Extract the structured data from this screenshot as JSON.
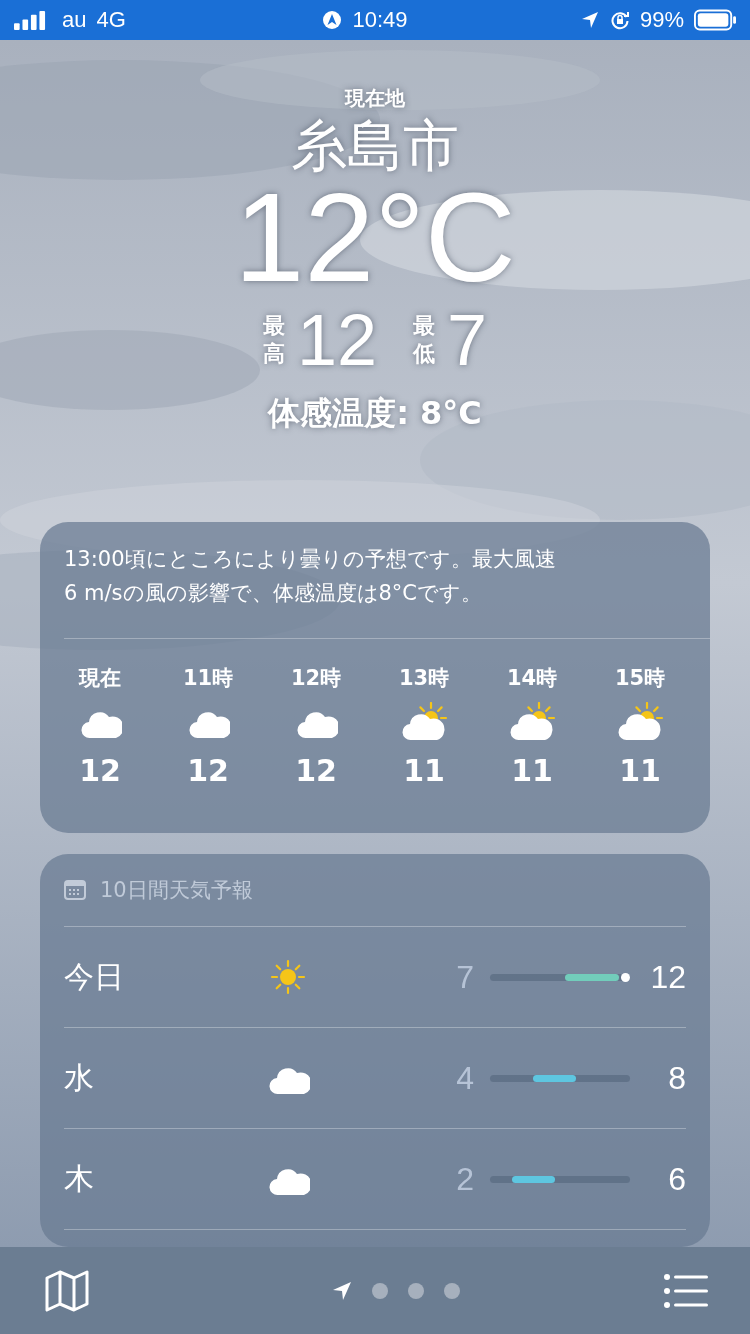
{
  "status_bar": {
    "carrier": "au",
    "network": "4G",
    "time": "10:49",
    "battery": "99%"
  },
  "header": {
    "label": "現在地",
    "city": "糸島市",
    "temperature": "12°C",
    "high_label": "最高",
    "high": "12",
    "low_label": "最低",
    "low": "7",
    "feels_like": "体感温度: 8°C"
  },
  "hourly": {
    "summary": "13:00頃にところにより曇りの予想です。最大風速\n6 m/sの風の影響で、体感温度は8°Cです。",
    "hours": [
      {
        "time": "現在",
        "kind": "cloud",
        "temp": "12"
      },
      {
        "time": "11時",
        "kind": "cloud",
        "temp": "12"
      },
      {
        "time": "12時",
        "kind": "cloud",
        "temp": "12"
      },
      {
        "time": "13時",
        "kind": "suncloud",
        "temp": "11"
      },
      {
        "time": "14時",
        "kind": "suncloud",
        "temp": "11"
      },
      {
        "time": "15時",
        "kind": "suncloud",
        "temp": "11"
      }
    ]
  },
  "daily": {
    "title": "10日間天気予報",
    "days": [
      {
        "day": "今日",
        "kind": "sun",
        "low": "7",
        "high": "12",
        "current_dot": true,
        "color": "#72cdbb"
      },
      {
        "day": "水",
        "kind": "cloud",
        "low": "4",
        "high": "8",
        "current_dot": false,
        "color": "#5ec6e0"
      },
      {
        "day": "木",
        "kind": "cloud",
        "low": "2",
        "high": "6",
        "current_dot": false,
        "color": "#5ec6e0"
      }
    ]
  },
  "tab_bar": {
    "pages": [
      {
        "kind": "location",
        "selected": true
      },
      {
        "kind": "dot",
        "selected": false
      },
      {
        "kind": "dot",
        "selected": false
      },
      {
        "kind": "dot",
        "selected": false
      }
    ]
  }
}
